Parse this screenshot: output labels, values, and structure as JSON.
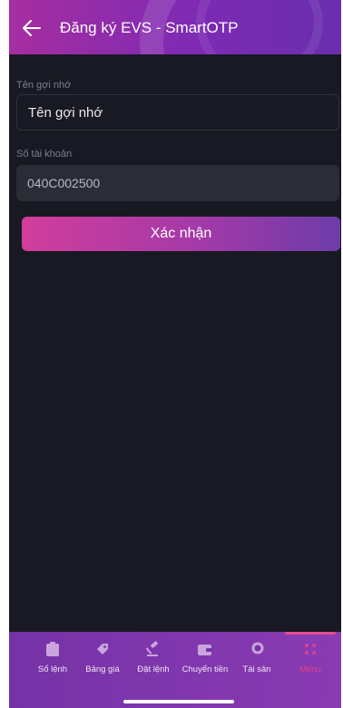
{
  "header": {
    "title": "Đăng ký EVS - SmartOTP",
    "back_icon": "arrow-left-icon"
  },
  "form": {
    "alias_label": "Tên gợi nhớ",
    "alias_placeholder": "Tên gợi nhớ",
    "account_label": "Số tài khoản",
    "account_value": "040C002500",
    "confirm_label": "Xác nhận"
  },
  "nav": {
    "items": [
      {
        "label": "Sổ lệnh",
        "icon": "clipboard-icon"
      },
      {
        "label": "Bảng giá",
        "icon": "tag-icon"
      },
      {
        "label": "Đặt lệnh",
        "icon": "gavel-icon"
      },
      {
        "label": "Chuyển tiền",
        "icon": "wallet-icon"
      },
      {
        "label": "Tài sản",
        "icon": "coins-icon"
      },
      {
        "label": "Menu",
        "icon": "grid-dots-icon"
      }
    ],
    "active_index": 5
  },
  "colors": {
    "background": "#181922",
    "accent": "#d23d9c",
    "nav": "#7532a6",
    "active": "#e0418f"
  }
}
